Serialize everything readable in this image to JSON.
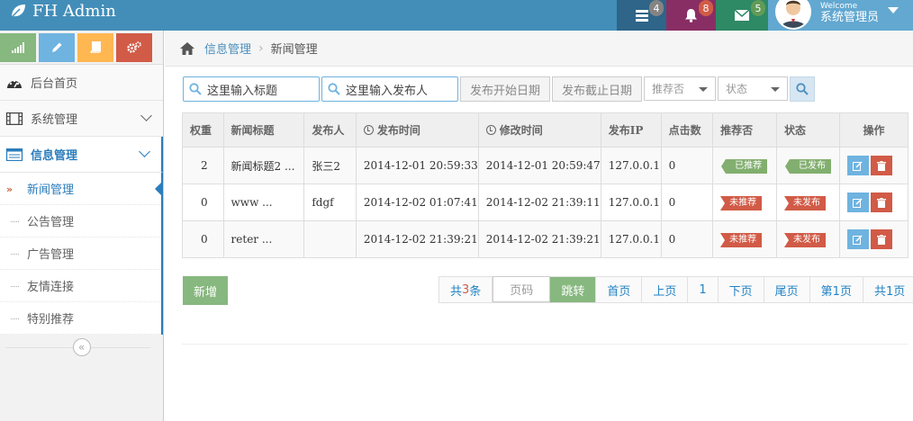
{
  "navbar": {
    "brand": "FH Admin",
    "badges": {
      "tasks": "4",
      "notifications": "8",
      "messages": "5"
    },
    "user": {
      "welcome": "Welcome",
      "name": "系统管理员"
    }
  },
  "sidebar": {
    "menu": [
      {
        "label": "后台首页"
      },
      {
        "label": "系统管理"
      },
      {
        "label": "信息管理"
      }
    ],
    "submenu": [
      {
        "label": "新闻管理"
      },
      {
        "label": "公告管理"
      },
      {
        "label": "广告管理"
      },
      {
        "label": "友情连接"
      },
      {
        "label": "特别推荐"
      }
    ]
  },
  "breadcrumb": {
    "parent": "信息管理",
    "current": "新闻管理"
  },
  "search": {
    "title_placeholder": "这里输入标题",
    "publisher_placeholder": "这里输入发布人",
    "start_date": "发布开始日期",
    "end_date": "发布截止日期",
    "recommend_select": "推荐否",
    "status_select": "状态"
  },
  "table": {
    "headers": [
      "权重",
      "新闻标题",
      "发布人",
      "发布时间",
      "修改时间",
      "发布IP",
      "点击数",
      "推荐否",
      "状态",
      "操作"
    ],
    "rows": [
      {
        "weight": "2",
        "title": "新闻标题2 ...",
        "publisher": "张三2",
        "pub_time": "2014-12-01 20:59:33",
        "mod_time": "2014-12-01 20:59:47",
        "ip": "127.0.0.1",
        "clicks": "0",
        "recommend": "已推荐",
        "status": "已发布"
      },
      {
        "weight": "0",
        "title": "www ...",
        "publisher": "fdgf",
        "pub_time": "2014-12-02 01:07:41",
        "mod_time": "2014-12-02 21:39:11",
        "ip": "127.0.0.1",
        "clicks": "0",
        "recommend": "未推荐",
        "status": "未发布"
      },
      {
        "weight": "0",
        "title": "reter ...",
        "publisher": "",
        "pub_time": "2014-12-02 21:39:21",
        "mod_time": "2014-12-02 21:39:21",
        "ip": "127.0.0.1",
        "clicks": "0",
        "recommend": "未推荐",
        "status": "未发布"
      }
    ]
  },
  "actions": {
    "add": "新增"
  },
  "pager": {
    "total_prefix": "共",
    "total_count": "3",
    "total_suffix": "条",
    "page_placeholder": "页码",
    "jump": "跳转",
    "first": "首页",
    "prev": "上页",
    "current": "1",
    "next": "下页",
    "last": "尾页",
    "page_info": "第1页",
    "total_pages": "共1页"
  },
  "colors": {
    "navbar": "#438eb9",
    "link": "#2283c5",
    "success": "#87b87f",
    "danger": "#d15b47",
    "info": "#6fb3e0"
  }
}
